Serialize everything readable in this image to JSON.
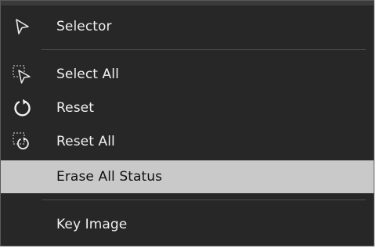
{
  "menu": {
    "items": [
      {
        "label": "Selector",
        "icon": "selector-arrow-icon"
      },
      {
        "label": "Select All",
        "icon": "select-all-icon"
      },
      {
        "label": "Reset",
        "icon": "reset-icon"
      },
      {
        "label": "Reset All",
        "icon": "reset-all-icon"
      },
      {
        "label": "Erase All Status",
        "icon": null,
        "highlighted": true
      },
      {
        "label": "Key Image",
        "icon": null
      }
    ]
  },
  "colors": {
    "background": "#272727",
    "text": "#f0f0f0",
    "highlight_bg": "#c9c9c9",
    "highlight_text": "#111111",
    "separator": "#4c4c4c"
  }
}
